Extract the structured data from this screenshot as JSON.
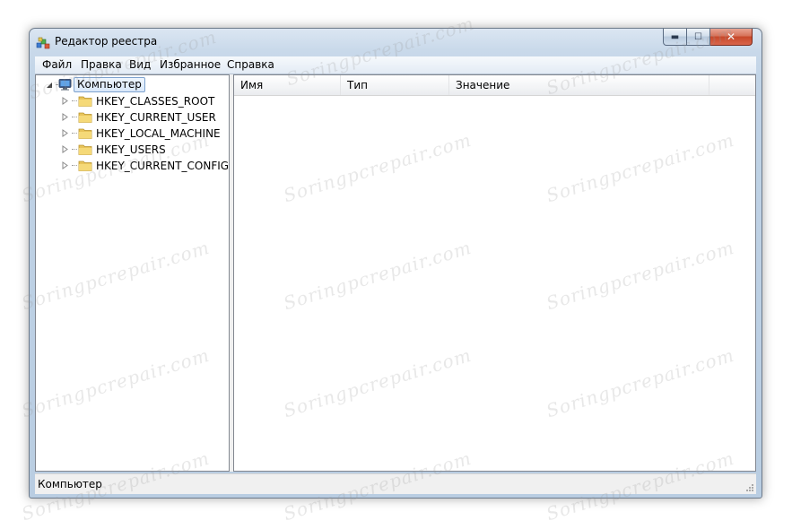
{
  "window": {
    "title": "Редактор реестра",
    "controls": {
      "minimize": "▬",
      "maximize": "☐",
      "close": "✕"
    }
  },
  "menu": [
    "Файл",
    "Правка",
    "Вид",
    "Избранное",
    "Справка"
  ],
  "tree": {
    "root": "Компьютер",
    "items": [
      "HKEY_CLASSES_ROOT",
      "HKEY_CURRENT_USER",
      "HKEY_LOCAL_MACHINE",
      "HKEY_USERS",
      "HKEY_CURRENT_CONFIG"
    ]
  },
  "list": {
    "columns": [
      "Имя",
      "Тип",
      "Значение"
    ]
  },
  "status": {
    "path": "Компьютер"
  },
  "watermark": "Soringpcrepair.com",
  "icons": {
    "app": "registry-editor-icon",
    "root": "computer-icon",
    "item": "folder-icon",
    "expander_root": "expanded-triangle-icon",
    "expander_item": "collapsed-triangle-icon"
  },
  "colors": {
    "selection_border": "#7da2ce",
    "folder": "#e8c45a",
    "close_button": "#c7482a"
  }
}
